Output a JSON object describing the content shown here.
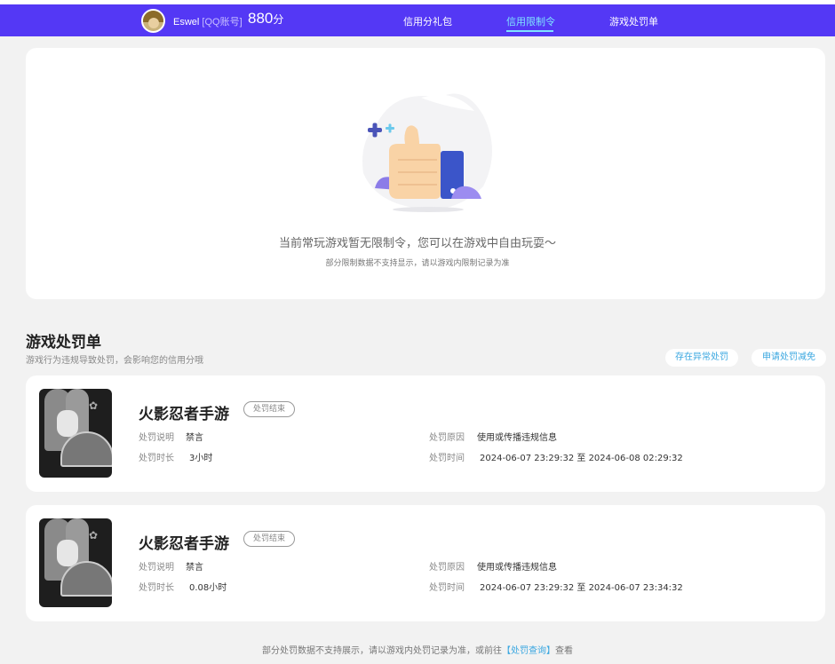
{
  "header": {
    "username": "Eswel",
    "account_type": "[QQ账号]",
    "score": "880",
    "score_unit": "分",
    "tabs": [
      {
        "label": "信用分礼包",
        "active": false
      },
      {
        "label": "信用限制令",
        "active": true
      },
      {
        "label": "游戏处罚单",
        "active": false
      }
    ]
  },
  "restriction": {
    "message": "当前常玩游戏暂无限制令，您可以在游戏中自由玩耍～",
    "note": "部分限制数据不支持显示，请以游戏内限制记录为准"
  },
  "penalty_section": {
    "title": "游戏处罚单",
    "description": "游戏行为违规导致处罚，会影响您的信用分哦",
    "report_button": "存在异常处罚",
    "appeal_button": "申请处罚减免"
  },
  "penalties": [
    {
      "game": "火影忍者手游",
      "status": "处罚结束",
      "desc_label": "处罚说明",
      "desc_value": "禁言",
      "duration_label": "处罚时长",
      "duration_value": "3小时",
      "reason_label": "处罚原因",
      "reason_value": "使用或传播违规信息",
      "time_label": "处罚时间",
      "time_value": "2024-06-07 23:29:32 至 2024-06-08 02:29:32"
    },
    {
      "game": "火影忍者手游",
      "status": "处罚结束",
      "desc_label": "处罚说明",
      "desc_value": "禁言",
      "duration_label": "处罚时长",
      "duration_value": "0.08小时",
      "reason_label": "处罚原因",
      "reason_value": "使用或传播违规信息",
      "time_label": "处罚时间",
      "time_value": "2024-06-07 23:29:32 至 2024-06-07 23:34:32"
    }
  ],
  "footer": {
    "text_before": "部分处罚数据不支持展示，请以游戏内处罚记录为准，或前往",
    "link": "【处罚查询】",
    "text_after": "查看"
  },
  "colors": {
    "header_bg": "#5438f5",
    "active_tab": "#7fe3ff",
    "link": "#3aa7e0"
  },
  "icons": [
    "avatar",
    "thumbs-up-illustration",
    "game-thumbnail"
  ]
}
